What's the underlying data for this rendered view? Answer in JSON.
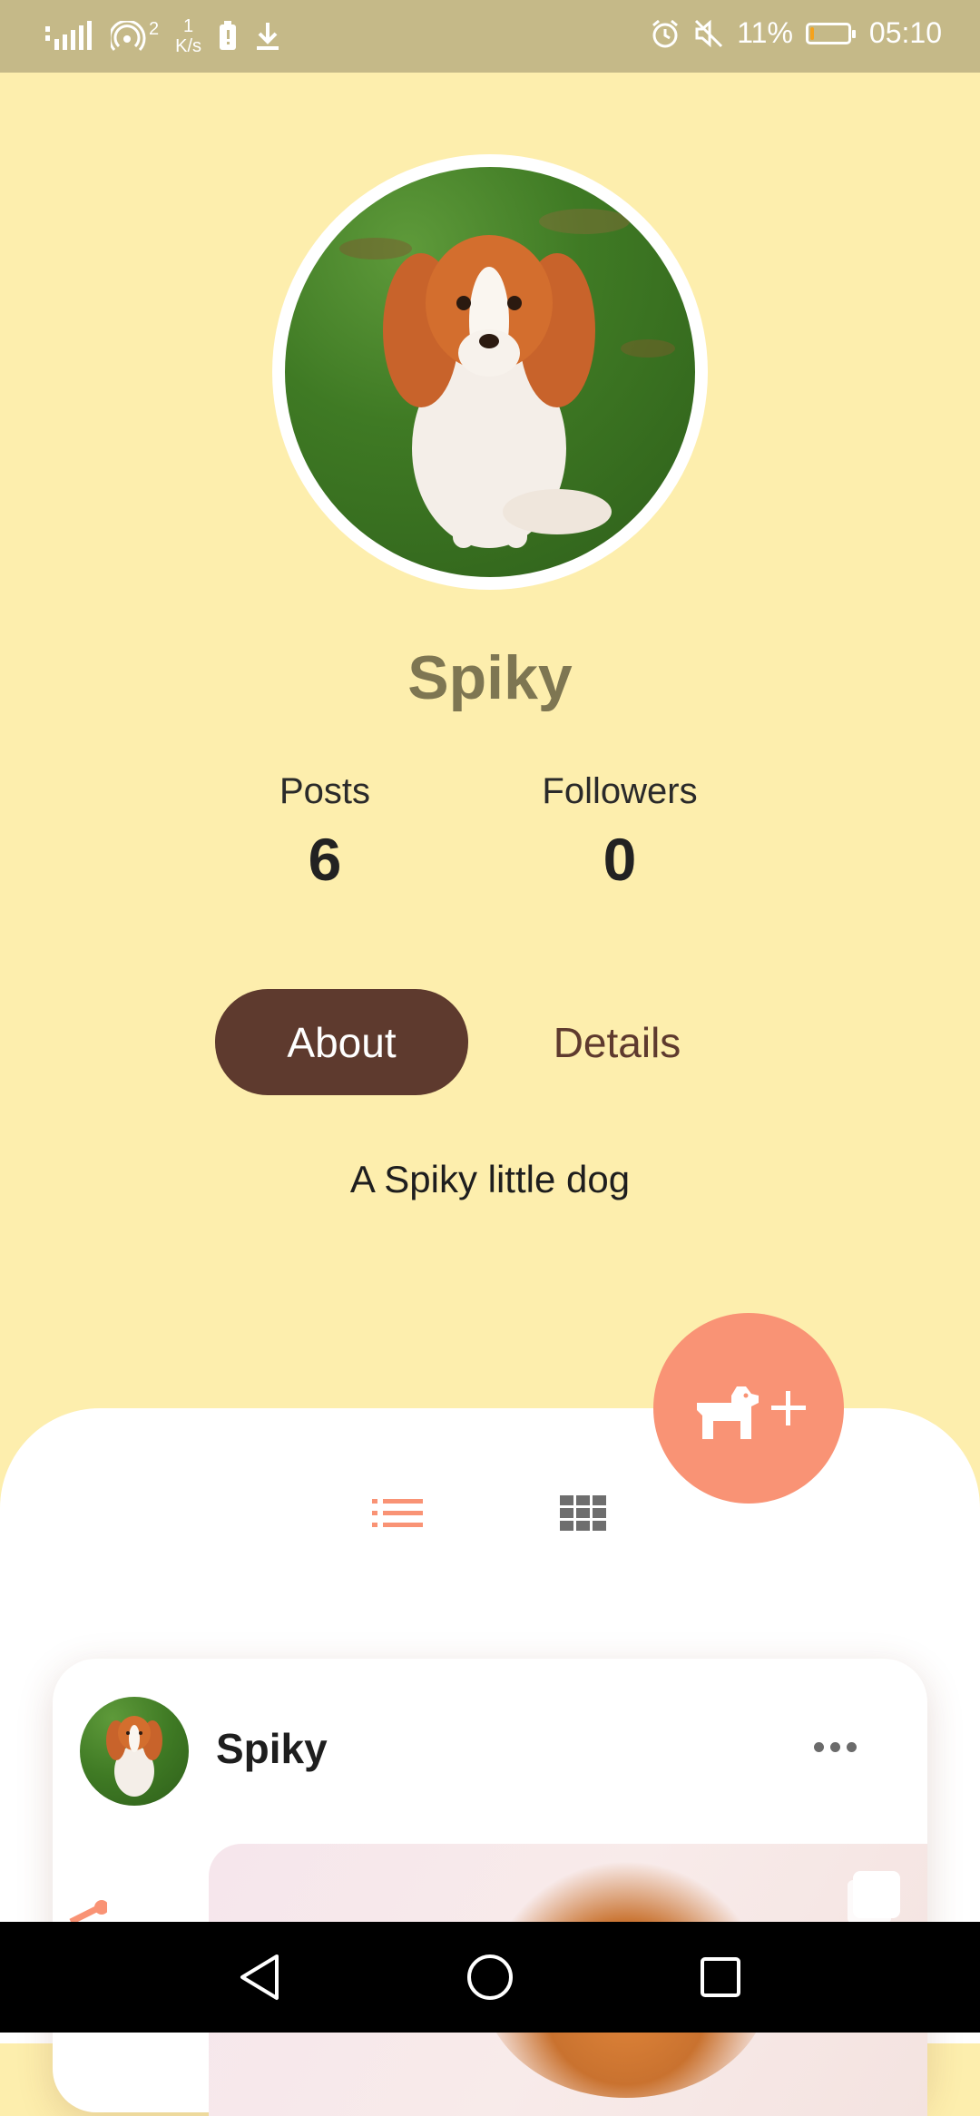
{
  "status_bar": {
    "signal": "4G",
    "hotspot_count": "2",
    "speed_value": "1",
    "speed_unit": "K/s",
    "battery_percent": "11%",
    "battery_level": 0.11,
    "time": "05:10",
    "icons": [
      "signal-icon",
      "hotspot-icon",
      "battery-saver-icon",
      "download-icon",
      "alarm-icon",
      "mute-icon"
    ]
  },
  "profile": {
    "name": "Spiky",
    "stats": [
      {
        "label": "Posts",
        "value": "6"
      },
      {
        "label": "Followers",
        "value": "0"
      }
    ],
    "tabs": {
      "about": "About",
      "details": "Details"
    },
    "bio": "A Spiky little dog"
  },
  "post": {
    "author": "Spiky"
  },
  "colors": {
    "background": "#FDEEAD",
    "status_bar": "#C5B988",
    "accent": "#F99375",
    "tab_active": "#5E3A2E",
    "name": "#7E7652"
  }
}
